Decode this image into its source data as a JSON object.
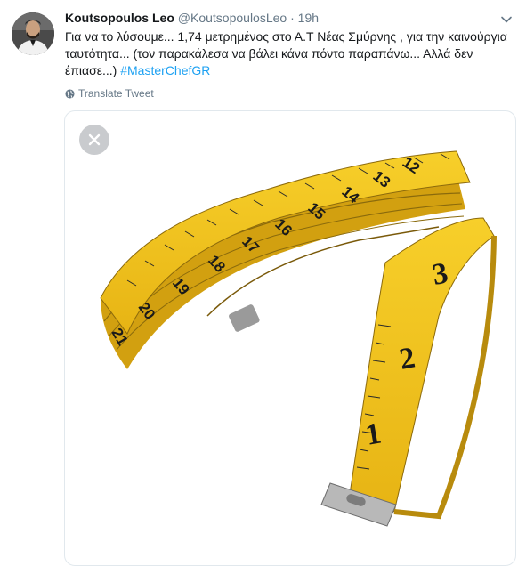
{
  "tweet": {
    "display_name": "Koutsopoulos Leo",
    "handle": "@KoutsopoulosLeo",
    "separator": "·",
    "time": "19h",
    "text": "Για να το λύσουμε... 1,74 μετρημένος στο Α.Τ Νέας Σμύρνης , για την καινούργια ταυτότητα... (τον παρακάλεσα να βάλει κάνα πόντο παραπάνω... Αλλά δεν έπιασε...) ",
    "hashtag": "#MasterChefGR",
    "translate_label": "Translate Tweet"
  },
  "media": {
    "tape_numbers": [
      "12",
      "13",
      "14",
      "15",
      "16",
      "17",
      "18",
      "19",
      "20",
      "21",
      "3",
      "2",
      "1"
    ]
  },
  "icons": {
    "caret": "chevron-down-icon",
    "translate": "globe-icon",
    "close": "close-icon"
  },
  "colors": {
    "link": "#1da1f2",
    "secondary_text": "#657786",
    "tape_yellow": "#f2c318",
    "close_button_bg": "#c9cbce"
  }
}
